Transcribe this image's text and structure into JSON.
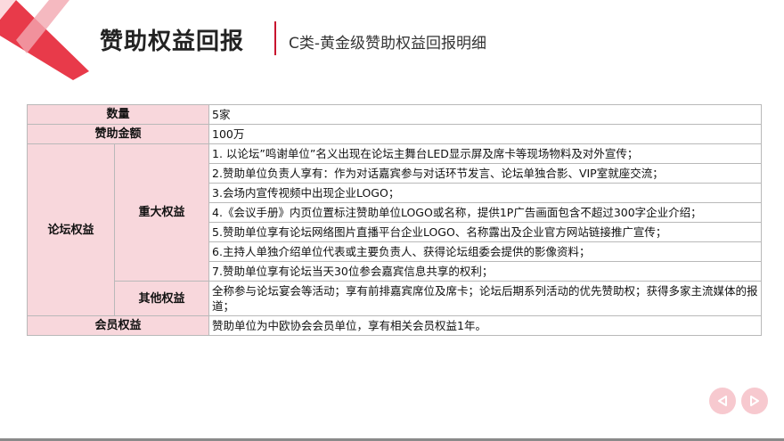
{
  "header": {
    "title": "赞助权益回报",
    "subtitle": "C类-黄金级赞助权益回报明细"
  },
  "table": {
    "quantity_label": "数量",
    "quantity_value": "5家",
    "amount_label": "赞助金额",
    "amount_value": "100万",
    "forum_label": "论坛权益",
    "major_label": "重大权益",
    "major_items": [
      "1. 以论坛”鸣谢单位”名义出现在论坛主舞台LED显示屏及席卡等现场物料及对外宣传；",
      "2.赞助单位负责人享有：作为对话嘉宾参与对话环节发言、论坛单独合影、VIP室就座交流；",
      "3.会场内宣传视频中出现企业LOGO；",
      "4.《会议手册》内页位置标注赞助单位LOGO或名称，提供1P广告画面包含不超过300字企业介绍；",
      "5.赞助单位享有论坛网络图片直播平台企业LOGO、名称露出及企业官方网站链接推广宣传；",
      "6.主持人单独介绍单位代表或主要负责人、获得论坛组委会提供的影像资料；",
      "7.赞助单位享有论坛当天30位参会嘉宾信息共享的权利；"
    ],
    "other_label": "其他权益",
    "other_value": "全称参与论坛宴会等活动；享有前排嘉宾席位及席卡；论坛后期系列活动的优先赞助权；获得多家主流媒体的报道；",
    "member_label": "会员权益",
    "member_value": "赞助单位为中欧协会会员单位，享有相关会员权益1年。"
  },
  "nav": {
    "prev_icon": "triangle-left-icon",
    "next_icon": "triangle-right-icon"
  },
  "colors": {
    "accent": "#c8102e",
    "header_fill": "#f8d7dc",
    "nav_fill": "#f7c9cf"
  }
}
